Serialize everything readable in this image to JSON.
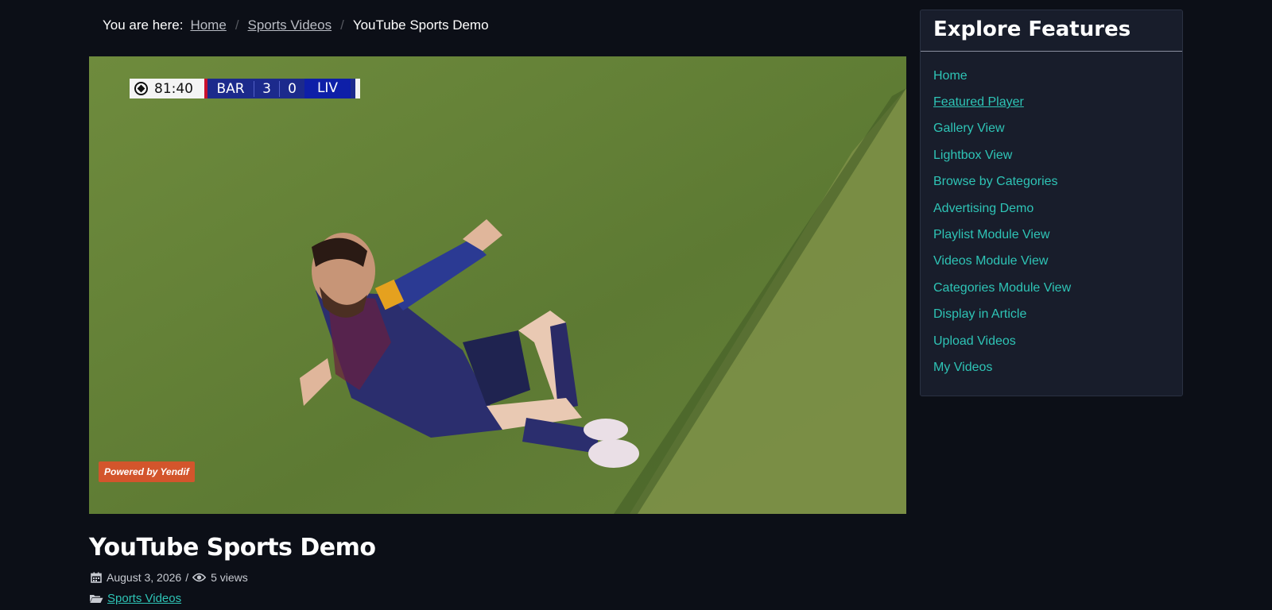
{
  "breadcrumb": {
    "prefix": "You are here:",
    "items": [
      "Home",
      "Sports Videos"
    ],
    "current": "YouTube Sports Demo"
  },
  "player": {
    "scorebug": {
      "time": "81:40",
      "home_team": "BAR",
      "home_score": "3",
      "away_score": "0",
      "away_team": "LIV"
    },
    "watermark": "Powered by Yendif"
  },
  "video": {
    "title": "YouTube Sports Demo",
    "date": "August 3, 2026",
    "separator": "/",
    "views": "5 views",
    "category": "Sports Videos"
  },
  "sidebar": {
    "title": "Explore Features",
    "items": [
      {
        "label": "Home"
      },
      {
        "label": "Featured Player"
      },
      {
        "label": "Gallery View"
      },
      {
        "label": "Lightbox View"
      },
      {
        "label": "Browse by Categories"
      },
      {
        "label": "Advertising Demo"
      },
      {
        "label": "Playlist Module View"
      },
      {
        "label": "Videos Module View"
      },
      {
        "label": "Categories Module View"
      },
      {
        "label": "Display in Article"
      },
      {
        "label": "Upload Videos"
      },
      {
        "label": "My Videos"
      }
    ],
    "active_index": 1
  },
  "colors": {
    "background": "#0c0f17",
    "accent": "#2ec4b6",
    "panel": "#181d2b",
    "watermark": "#d3552c"
  },
  "icons": [
    "calendar-icon",
    "eye-icon",
    "folder-open-icon",
    "football-icon"
  ]
}
